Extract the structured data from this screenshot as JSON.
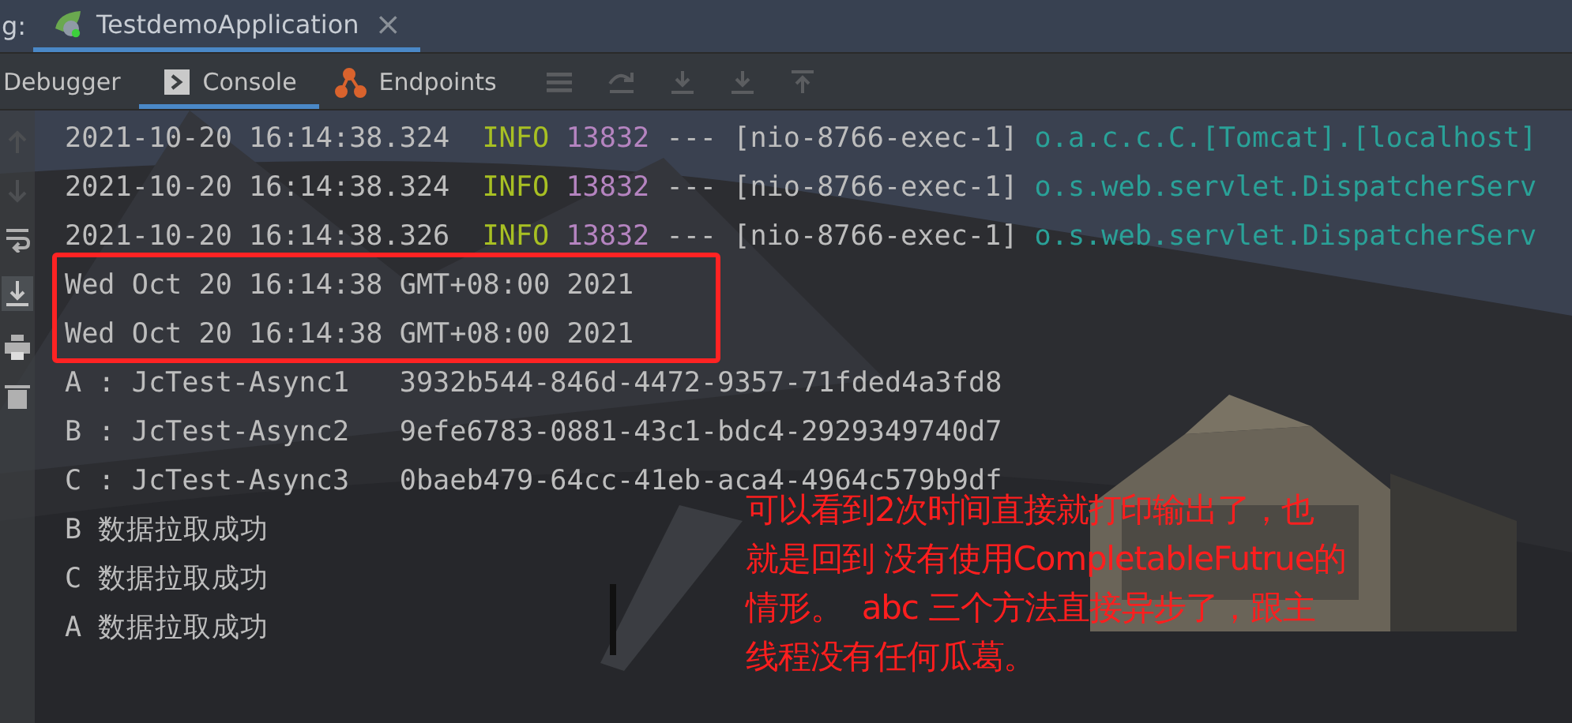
{
  "run_tab": {
    "prefix": "g:",
    "title": "TestdemoApplication",
    "close": "×",
    "selected": true
  },
  "tool_tabs": [
    {
      "label": "Debugger",
      "selected": false,
      "kind": "plain"
    },
    {
      "label": "Console",
      "selected": true,
      "kind": "console"
    },
    {
      "label": "Endpoints",
      "selected": false,
      "kind": "endpoints"
    }
  ],
  "console_lines": [
    {
      "kind": "log",
      "highlighted": false,
      "time": "2021-10-20 16:14:38.324",
      "level": "INFO",
      "pid": "13832",
      "sep": "---",
      "thread": "[nio-8766-exec-1]",
      "logger": "o.a.c.c.C.[Tomcat].[localhost]"
    },
    {
      "kind": "log",
      "highlighted": false,
      "time": "2021-10-20 16:14:38.324",
      "level": "INFO",
      "pid": "13832",
      "sep": "---",
      "thread": "[nio-8766-exec-1]",
      "logger": "o.s.web.servlet.DispatcherServ"
    },
    {
      "kind": "log",
      "highlighted": false,
      "time": "2021-10-20 16:14:38.326",
      "level": "INFO",
      "pid": "13832",
      "sep": "---",
      "thread": "[nio-8766-exec-1]",
      "logger": "o.s.web.servlet.DispatcherServ"
    },
    {
      "kind": "plain",
      "highlighted": true,
      "text": "Wed Oct 20 16:14:38 GMT+08:00 2021"
    },
    {
      "kind": "plain",
      "highlighted": true,
      "text": "Wed Oct 20 16:14:38 GMT+08:00 2021"
    },
    {
      "kind": "plain",
      "highlighted": false,
      "text": "A : JcTest-Async1   3932b544-846d-4472-9357-71fded4a3fd8"
    },
    {
      "kind": "plain",
      "highlighted": false,
      "text": "B : JcTest-Async2   9efe6783-0881-43c1-bdc4-2929349740d7"
    },
    {
      "kind": "plain",
      "highlighted": false,
      "text": "C : JcTest-Async3   0baeb479-64cc-41eb-aca4-4964c579b9df"
    },
    {
      "kind": "plain",
      "highlighted": false,
      "text": "B 数据拉取成功"
    },
    {
      "kind": "plain",
      "highlighted": false,
      "text": "C 数据拉取成功"
    },
    {
      "kind": "plain",
      "highlighted": false,
      "text": "A 数据拉取成功"
    }
  ],
  "annotation": {
    "lines": [
      "可以看到2次时间直接就打印输出了，也",
      "就是回到 没有使用CompletableFutrue的",
      "情形。  abc 三个方法直接异步了，跟主",
      "线程没有任何瓜葛。"
    ]
  }
}
